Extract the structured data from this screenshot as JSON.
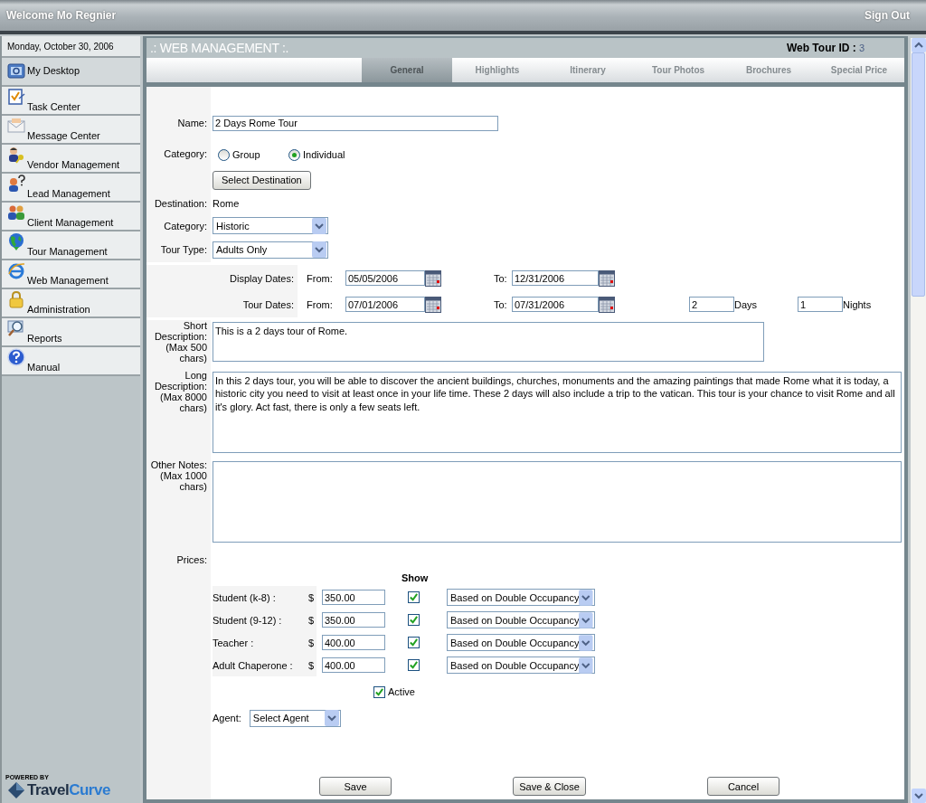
{
  "header": {
    "welcome": "Welcome Mo Regnier",
    "sign_out": "Sign Out"
  },
  "sidebar": {
    "date": "Monday, October 30, 2006",
    "items": [
      {
        "label": "My Desktop",
        "selected": true
      },
      {
        "label": "Task Center",
        "selected": false
      },
      {
        "label": "Message Center",
        "selected": false
      },
      {
        "label": "Vendor Management",
        "selected": false
      },
      {
        "label": "Lead Management",
        "selected": false
      },
      {
        "label": "Client Management",
        "selected": false
      },
      {
        "label": "Tour Management",
        "selected": false
      },
      {
        "label": "Web Management",
        "selected": false
      },
      {
        "label": "Administration",
        "selected": false
      },
      {
        "label": "Reports",
        "selected": false
      },
      {
        "label": "Manual",
        "selected": false
      }
    ],
    "powered_by": "POWERED BY",
    "brand_first": "Travel",
    "brand_second": "Curve"
  },
  "panel": {
    "title": ".: WEB MANAGEMENT :.",
    "tour_id_label": "Web Tour ID :",
    "tour_id": "3"
  },
  "tabs": [
    {
      "label": "General",
      "selected": true
    },
    {
      "label": "Highlights",
      "selected": false
    },
    {
      "label": "Itinerary",
      "selected": false
    },
    {
      "label": "Tour Photos",
      "selected": false
    },
    {
      "label": "Brochures",
      "selected": false
    },
    {
      "label": "Special Price",
      "selected": false
    }
  ],
  "form": {
    "name_label": "Name:",
    "name": "2 Days Rome Tour",
    "group_label": "Category:",
    "group_options": [
      {
        "label": "Group",
        "selected": false
      },
      {
        "label": "Individual",
        "selected": true
      }
    ],
    "select_destination": "Select Destination",
    "destination_label": "Destination:",
    "destination": "Rome",
    "category_label": "Category:",
    "category": "Historic",
    "tour_type_label": "Tour Type:",
    "tour_type": "Adults Only",
    "date_rows": [
      {
        "label": "Display Dates:",
        "from_label": "From:",
        "from": "05/05/2006",
        "to_label": "To:",
        "to": "12/31/2006"
      },
      {
        "label": "Tour Dates:",
        "from_label": "From:",
        "from": "07/01/2006",
        "to_label": "To:",
        "to": "07/31/2006",
        "days": "2",
        "days_label": "Days",
        "nights": "1",
        "nights_label": "Nights"
      }
    ],
    "short_label": "Short Description: (Max 500 chars)",
    "short": "This is a 2 days tour of Rome.",
    "long_label": "Long Description: (Max 8000 chars)",
    "long": "In this 2 days tour, you will be able to discover the ancient buildings, churches, monuments and the amazing paintings that made Rome what it is today, a historic city you need to visit at least once in your life time. These 2 days will also include a trip to the vatican. This tour is your chance to visit Rome and all it's glory. Act fast, there is only a few seats left.",
    "notes_label": "Other Notes: (Max 1000 chars)",
    "prices_label": "Prices:",
    "show_label": "Show",
    "prices": [
      {
        "label": "Student (k-8) :",
        "currency": "$",
        "value": "350.00",
        "checked": true,
        "basis": "Based on Double Occupancy"
      },
      {
        "label": "Student (9-12) :",
        "currency": "$",
        "value": "350.00",
        "checked": true,
        "basis": "Based on Double Occupancy"
      },
      {
        "label": "Teacher :",
        "currency": "$",
        "value": "400.00",
        "checked": true,
        "basis": "Based on Double Occupancy"
      },
      {
        "label": "Adult Chaperone :",
        "currency": "$",
        "value": "400.00",
        "checked": true,
        "basis": "Based on Double Occupancy"
      }
    ],
    "active": {
      "label": "Active",
      "checked": true
    },
    "agent_label": "Agent:",
    "agent": "Select Agent"
  },
  "buttons": [
    "Save",
    "Save & Close",
    "Cancel"
  ]
}
